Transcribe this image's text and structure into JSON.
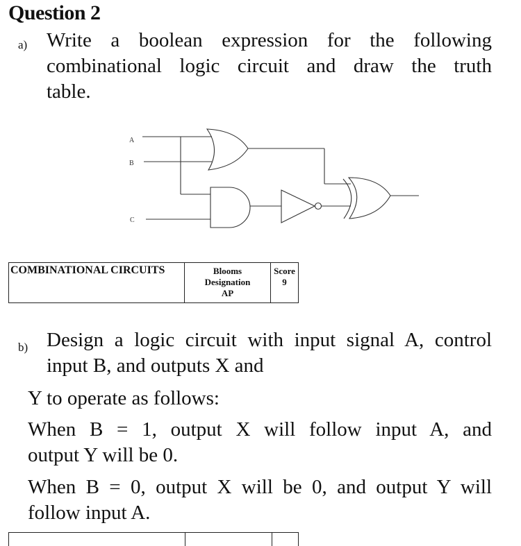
{
  "question": {
    "title": "Question 2",
    "part_a": {
      "marker": "a)",
      "lines": [
        "Write a boolean expression for the following",
        "combinational logic circuit and draw the truth",
        "table."
      ]
    },
    "circuit": {
      "inputs": [
        "A",
        "B",
        "C"
      ],
      "gates": [
        "OR",
        "AND",
        "NOT",
        "XOR"
      ],
      "description": "A and B into OR gate; A and C into AND gate; AND output into NOT gate; OR output and NOT output into XOR gate producing final output"
    },
    "info_table": {
      "topic": "COMBINATIONAL CIRCUITS",
      "blooms_label_1": "Blooms",
      "blooms_label_2": "Designation",
      "blooms_value": "AP",
      "score_label": "Score",
      "score_value": "9"
    },
    "part_b": {
      "marker": "b)",
      "lines": [
        "Design a logic circuit with input signal A, control",
        "input B, and outputs X and",
        "Y to operate as follows:",
        "When B = 1, output X will follow input A, and",
        "output Y will be 0.",
        "When B = 0, output X will be 0, and output Y will",
        "follow input A."
      ]
    }
  }
}
